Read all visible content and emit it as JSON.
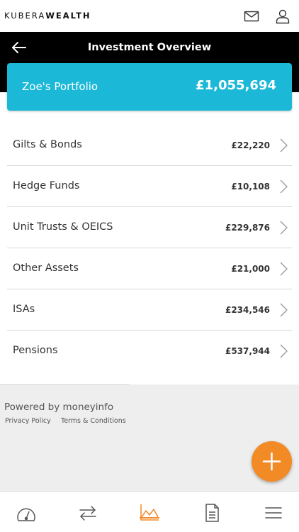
{
  "brand": {
    "part1": "KUBERA",
    "part2": "WEALTH"
  },
  "header": {
    "title": "Investment Overview"
  },
  "portfolio": {
    "name": "Zoe's Portfolio",
    "value": "£1,055,694"
  },
  "holdings": [
    {
      "label": "Gilts & Bonds",
      "value": "£22,220"
    },
    {
      "label": "Hedge Funds",
      "value": "£10,108"
    },
    {
      "label": "Unit Trusts & OEICS",
      "value": "£229,876"
    },
    {
      "label": "Other Assets",
      "value": "£21,000"
    },
    {
      "label": "ISAs",
      "value": "£234,546"
    },
    {
      "label": "Pensions",
      "value": "£537,944"
    }
  ],
  "footer": {
    "powered_by": "Powered by moneyinfo",
    "privacy_policy": "Privacy Policy",
    "terms": "Terms & Conditions"
  },
  "icons": {
    "top": [
      "mail-icon",
      "user-icon"
    ],
    "back": "arrow-left-icon",
    "row": "chevron-right-icon",
    "fab": "plus-icon",
    "tabs": [
      "dashboard-gauge-icon",
      "transfer-arrows-icon",
      "area-chart-icon",
      "document-icon",
      "menu-icon"
    ]
  },
  "colors": {
    "accent": "#1cb8d8",
    "fab": "#f28a25",
    "active_tab": "#f28a25",
    "header_bg": "#000000",
    "footer_bg": "#eeeeee"
  },
  "tabs": {
    "active_index": 2
  }
}
